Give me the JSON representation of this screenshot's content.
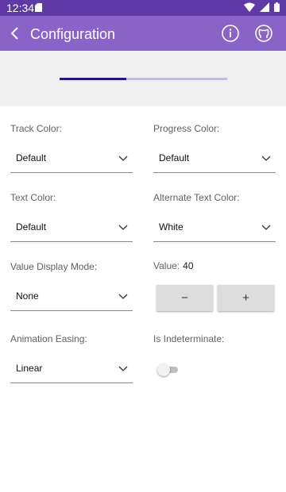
{
  "status_bar": {
    "time": "12:34",
    "icons": [
      "sd-card-icon",
      "wifi-icon",
      "signal-icon",
      "battery-icon"
    ]
  },
  "app_bar": {
    "title": "Configuration",
    "icons": [
      "back-arrow-icon",
      "info-icon",
      "github-icon"
    ]
  },
  "preview": {
    "progress_value": 40,
    "progress_max": 100
  },
  "fields": {
    "track_color": {
      "label": "Track Color:",
      "value": "Default"
    },
    "progress_color": {
      "label": "Progress Color:",
      "value": "Default"
    },
    "text_color": {
      "label": "Text Color:",
      "value": "Default"
    },
    "alternate_text_color": {
      "label": "Alternate Text Color:",
      "value": "White"
    },
    "value_display_mode": {
      "label": "Value Display Mode:",
      "value": "None"
    },
    "value": {
      "label": "Value:",
      "number": "40",
      "decrement": "−",
      "increment": "+"
    },
    "animation_easing": {
      "label": "Animation Easing:",
      "value": "Linear"
    },
    "is_indeterminate": {
      "label": "Is Indeterminate:",
      "checked": false
    }
  },
  "colors": {
    "app_bar": "#8a63c9",
    "status_bar": "#5f3aa6",
    "progress_fill": "#2a1185",
    "progress_track": "#c4bde2"
  }
}
